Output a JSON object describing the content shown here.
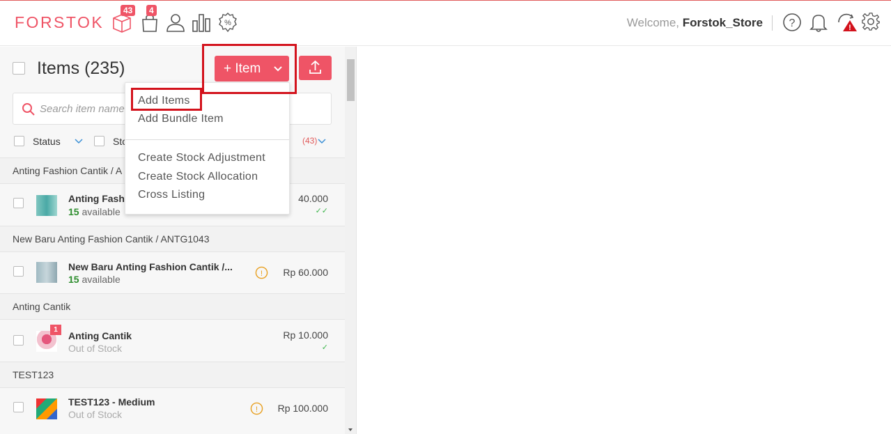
{
  "header": {
    "logo": "FORSTOK",
    "badges": {
      "products": "43",
      "orders": "4"
    },
    "welcome_prefix": "Welcome,",
    "store_name": "Forstok_Store",
    "nav_icons": [
      "box-icon",
      "bag-icon",
      "user-icon",
      "chart-icon",
      "discount-icon"
    ],
    "right_icons": [
      "help-icon",
      "bell-icon",
      "sync-warning-icon",
      "gear-icon"
    ]
  },
  "toolbar": {
    "title": "Items",
    "count": "(235)",
    "add_button_label": "+ Item",
    "brand_color": "#ef5466"
  },
  "search": {
    "placeholder": "Search item name"
  },
  "filters": {
    "status_label": "Status",
    "stock_label": "Sto",
    "channel_count": "(43)"
  },
  "dropdown": {
    "items": [
      "Add Items",
      "Add Bundle Item",
      "Create Stock Adjustment",
      "Create Stock Allocation",
      "Cross Listing"
    ]
  },
  "groups": [
    {
      "header": "Anting Fashion Cantik / A",
      "item": {
        "name": "Anting Fash",
        "stock_num": "15",
        "stock_text": "available",
        "price": "40.000",
        "checks": "✓✓"
      }
    },
    {
      "header": "New Baru Anting Fashion Cantik / ANTG1043",
      "item": {
        "name": "New Baru Anting Fashion Cantik /...",
        "stock_num": "15",
        "stock_text": "available",
        "price": "Rp 60.000"
      }
    },
    {
      "header": "Anting Cantik",
      "item": {
        "name": "Anting Cantik",
        "stock_text": "Out of Stock",
        "price": "Rp 10.000",
        "badge": "1",
        "checks": "✓"
      }
    },
    {
      "header": "TEST123",
      "item": {
        "name": "TEST123 - Medium",
        "stock_text": "Out of Stock",
        "price": "Rp 100.000"
      }
    }
  ]
}
